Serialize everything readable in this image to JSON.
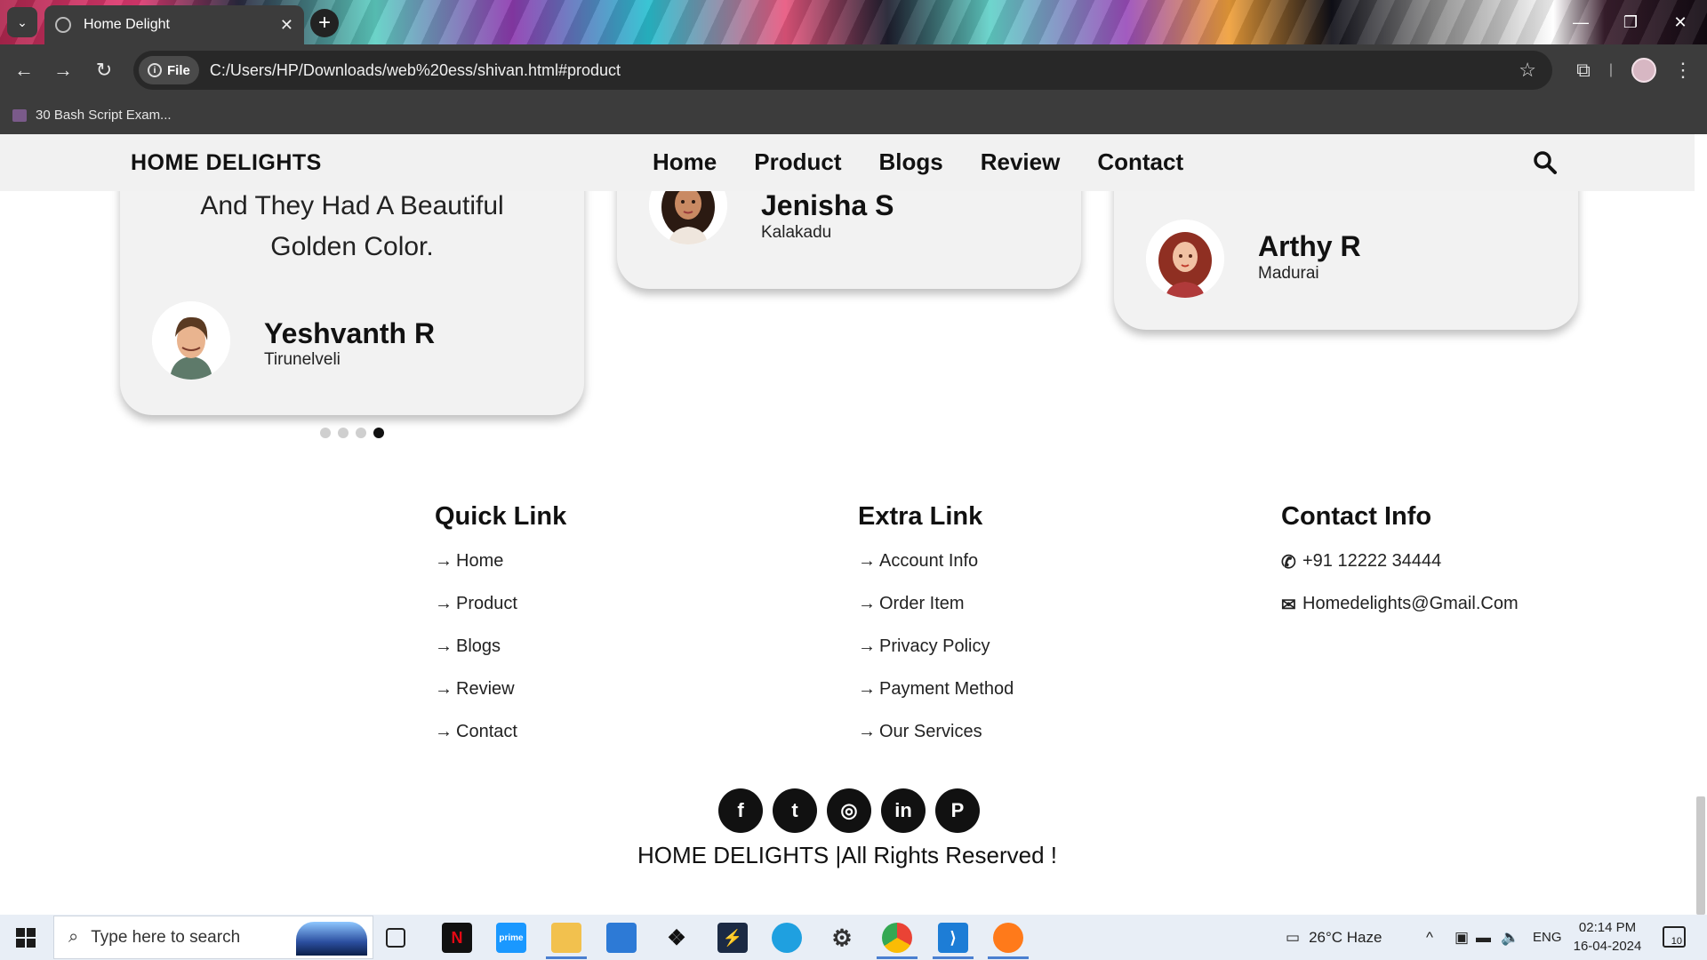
{
  "browser": {
    "tab_title": "Home Delight",
    "new_tab": "+",
    "address": {
      "scheme_chip": "File",
      "url": "C:/Users/HP/Downloads/web%20ess/shivan.html#product"
    },
    "bookmarks": [
      {
        "label": "30 Bash Script Exam..."
      }
    ]
  },
  "site": {
    "logo": "HOME DELIGHTS",
    "nav": [
      "Home",
      "Product",
      "Blogs",
      "Review",
      "Contact"
    ]
  },
  "reviews": [
    {
      "quote": "And They Had A Beautiful Golden Color.",
      "name": "Yeshvanth R",
      "city": "Tirunelveli"
    },
    {
      "name": "Jenisha S",
      "city": "Kalakadu"
    },
    {
      "name": "Arthy R",
      "city": "Madurai"
    }
  ],
  "carousel": {
    "total_slides": 4,
    "active_index": 3
  },
  "footer": {
    "quick_link": {
      "heading": "Quick Link",
      "links": [
        "Home",
        "Product",
        "Blogs",
        "Review",
        "Contact"
      ]
    },
    "extra_link": {
      "heading": "Extra Link",
      "links": [
        "Account Info",
        "Order Item",
        "Privacy Policy",
        "Payment Method",
        "Our Services"
      ]
    },
    "contact_info": {
      "heading": "Contact Info",
      "phone": "+91 12222 34444",
      "email": "Homedelights@Gmail.Com"
    },
    "socials": [
      {
        "name": "facebook",
        "glyph": "f"
      },
      {
        "name": "twitter",
        "glyph": "t"
      },
      {
        "name": "instagram",
        "glyph": "◎"
      },
      {
        "name": "linkedin",
        "glyph": "in"
      },
      {
        "name": "pinterest",
        "glyph": "P"
      }
    ],
    "copyright": "HOME DELIGHTS |All Rights Reserved !"
  },
  "taskbar": {
    "search_placeholder": "Type here to search",
    "weather": "26°C  Haze",
    "language": "ENG",
    "time": "02:14 PM",
    "date": "16-04-2024",
    "notifications": "10"
  },
  "colors": {
    "chrome_dark": "#3c3c3c",
    "header_bg": "#f1f1f1",
    "card_bg": "#f2f2f2",
    "text": "#111111"
  }
}
